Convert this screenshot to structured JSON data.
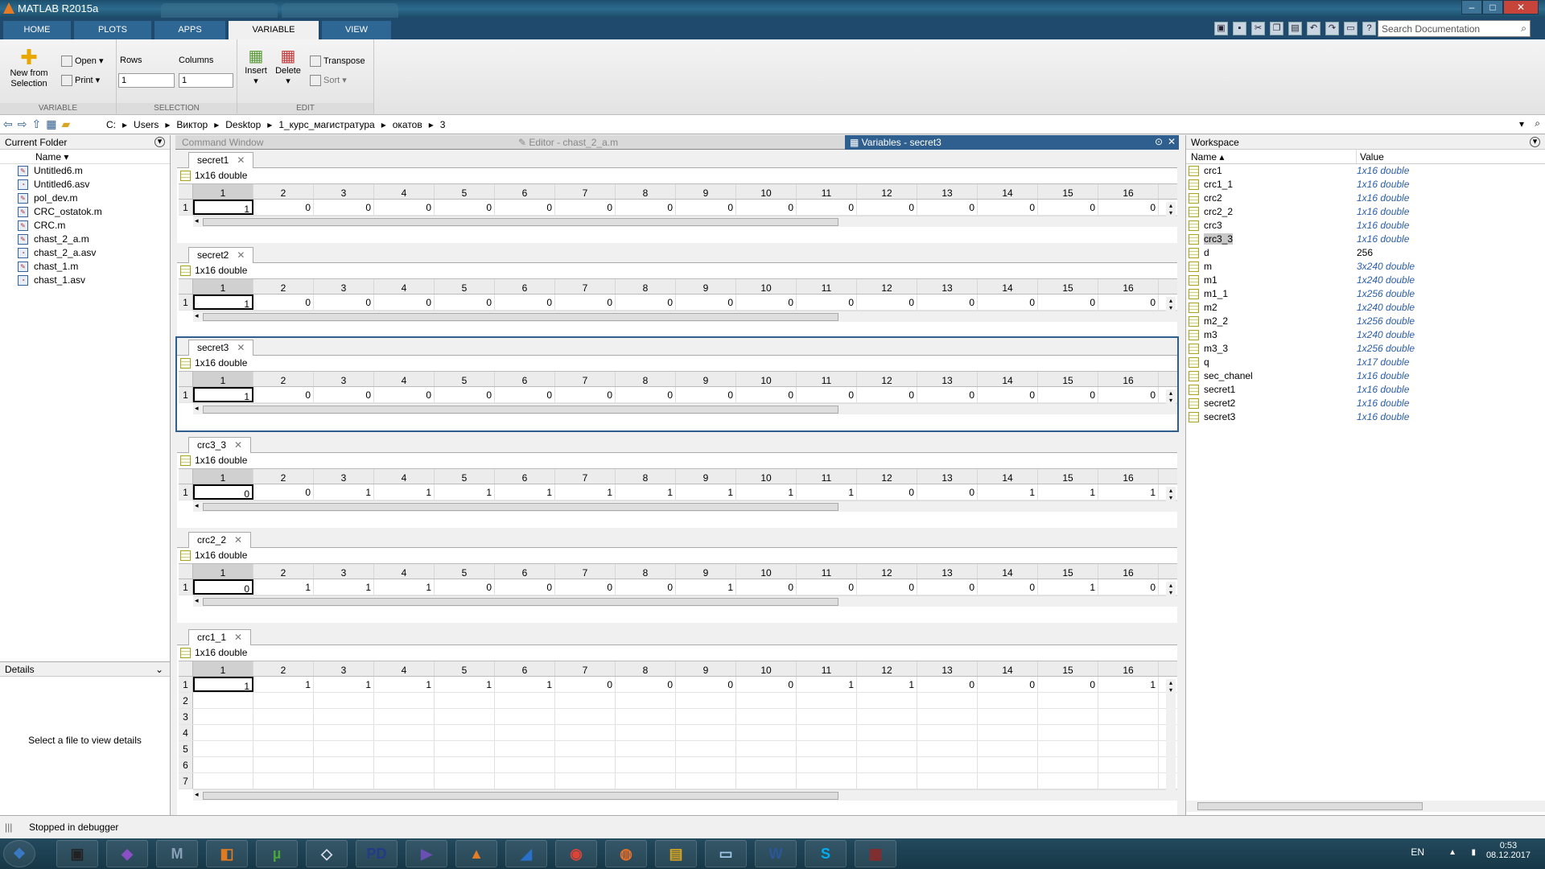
{
  "window": {
    "title": "MATLAB R2015a",
    "min": "–",
    "max": "□",
    "close": "✕"
  },
  "ribbon_tabs": [
    "HOME",
    "PLOTS",
    "APPS",
    "VARIABLE",
    "VIEW"
  ],
  "search_placeholder": "Search Documentation",
  "ribbon": {
    "new_from_selection": "New from\nSelection",
    "open": "Open",
    "print": "Print",
    "rows_label": "Rows",
    "columns_label": "Columns",
    "rows_value": "1",
    "columns_value": "1",
    "insert": "Insert",
    "delete": "Delete",
    "transpose": "Transpose",
    "sort": "Sort",
    "group_variable": "VARIABLE",
    "group_selection": "SELECTION",
    "group_edit": "EDIT"
  },
  "path": [
    "C:",
    "Users",
    "Виктор",
    "Desktop",
    "1_курс_магистратура",
    "окатов",
    "3"
  ],
  "current_folder": {
    "title": "Current Folder",
    "name_header": "Name",
    "files": [
      "Untitled6.m",
      "Untitled6.asv",
      "pol_dev.m",
      "CRC_ostatok.m",
      "CRC.m",
      "chast_2_a.m",
      "chast_2_a.asv",
      "chast_1.m",
      "chast_1.asv"
    ],
    "icons": [
      "m-file-icon",
      "asv-file-icon",
      "m-file-icon",
      "m-file-icon",
      "m-file-icon",
      "m-file-icon",
      "asv-file-icon",
      "m-file-icon",
      "asv-file-icon"
    ]
  },
  "details": {
    "title": "Details",
    "message": "Select a file to view details"
  },
  "doc_tabs": [
    "Command Window",
    "Editor - chast_2_a.m",
    "Variables - secret3"
  ],
  "columns": [
    "1",
    "2",
    "3",
    "4",
    "5",
    "6",
    "7",
    "8",
    "9",
    "10",
    "11",
    "12",
    "13",
    "14",
    "15",
    "16"
  ],
  "variables": [
    {
      "name": "secret1",
      "size": "1x16 double",
      "rows": [
        [
          "1",
          "0",
          "0",
          "0",
          "0",
          "0",
          "0",
          "0",
          "0",
          "0",
          "0",
          "0",
          "0",
          "0",
          "0",
          "0"
        ]
      ]
    },
    {
      "name": "secret2",
      "size": "1x16 double",
      "rows": [
        [
          "1",
          "0",
          "0",
          "0",
          "0",
          "0",
          "0",
          "0",
          "0",
          "0",
          "0",
          "0",
          "0",
          "0",
          "0",
          "0"
        ]
      ]
    },
    {
      "name": "secret3",
      "size": "1x16 double",
      "rows": [
        [
          "1",
          "0",
          "0",
          "0",
          "0",
          "0",
          "0",
          "0",
          "0",
          "0",
          "0",
          "0",
          "0",
          "0",
          "0",
          "0"
        ]
      ]
    },
    {
      "name": "crc3_3",
      "size": "1x16 double",
      "rows": [
        [
          "0",
          "0",
          "1",
          "1",
          "1",
          "1",
          "1",
          "1",
          "1",
          "1",
          "1",
          "0",
          "0",
          "1",
          "1",
          "1"
        ]
      ]
    },
    {
      "name": "crc2_2",
      "size": "1x16 double",
      "rows": [
        [
          "0",
          "1",
          "1",
          "1",
          "0",
          "0",
          "0",
          "0",
          "1",
          "0",
          "0",
          "0",
          "0",
          "0",
          "1",
          "0"
        ]
      ]
    },
    {
      "name": "crc1_1",
      "size": "1x16 double",
      "rows": [
        [
          "1",
          "1",
          "1",
          "1",
          "1",
          "1",
          "0",
          "0",
          "0",
          "0",
          "1",
          "1",
          "0",
          "0",
          "0",
          "1"
        ]
      ],
      "row_labels": [
        "1",
        "2",
        "3",
        "4",
        "5",
        "6",
        "7"
      ]
    }
  ],
  "workspace": {
    "title": "Workspace",
    "name_header": "Name",
    "value_header": "Value",
    "items": [
      {
        "name": "crc1",
        "value": "1x16 double"
      },
      {
        "name": "crc1_1",
        "value": "1x16 double"
      },
      {
        "name": "crc2",
        "value": "1x16 double"
      },
      {
        "name": "crc2_2",
        "value": "1x16 double"
      },
      {
        "name": "crc3",
        "value": "1x16 double"
      },
      {
        "name": "crc3_3",
        "value": "1x16 double"
      },
      {
        "name": "d",
        "value": "256"
      },
      {
        "name": "m",
        "value": "3x240 double"
      },
      {
        "name": "m1",
        "value": "1x240 double"
      },
      {
        "name": "m1_1",
        "value": "1x256 double"
      },
      {
        "name": "m2",
        "value": "1x240 double"
      },
      {
        "name": "m2_2",
        "value": "1x256 double"
      },
      {
        "name": "m3",
        "value": "1x240 double"
      },
      {
        "name": "m3_3",
        "value": "1x256 double"
      },
      {
        "name": "q",
        "value": "1x17 double"
      },
      {
        "name": "sec_chanel",
        "value": "1x16 double"
      },
      {
        "name": "secret1",
        "value": "1x16 double"
      },
      {
        "name": "secret2",
        "value": "1x16 double"
      },
      {
        "name": "secret3",
        "value": "1x16 double"
      }
    ]
  },
  "status": "Stopped in debugger",
  "taskbar": {
    "apps": [
      "start",
      "media",
      "visual-studio",
      "m-app",
      "sublime",
      "utorrent",
      "unity",
      "pd",
      "vs-blue",
      "matlab",
      "app-blue",
      "chrome",
      "firefox",
      "explorer",
      "notes",
      "word",
      "skype",
      "winrar"
    ],
    "lang": "EN",
    "time": "0:53",
    "date": "08.12.2017"
  }
}
